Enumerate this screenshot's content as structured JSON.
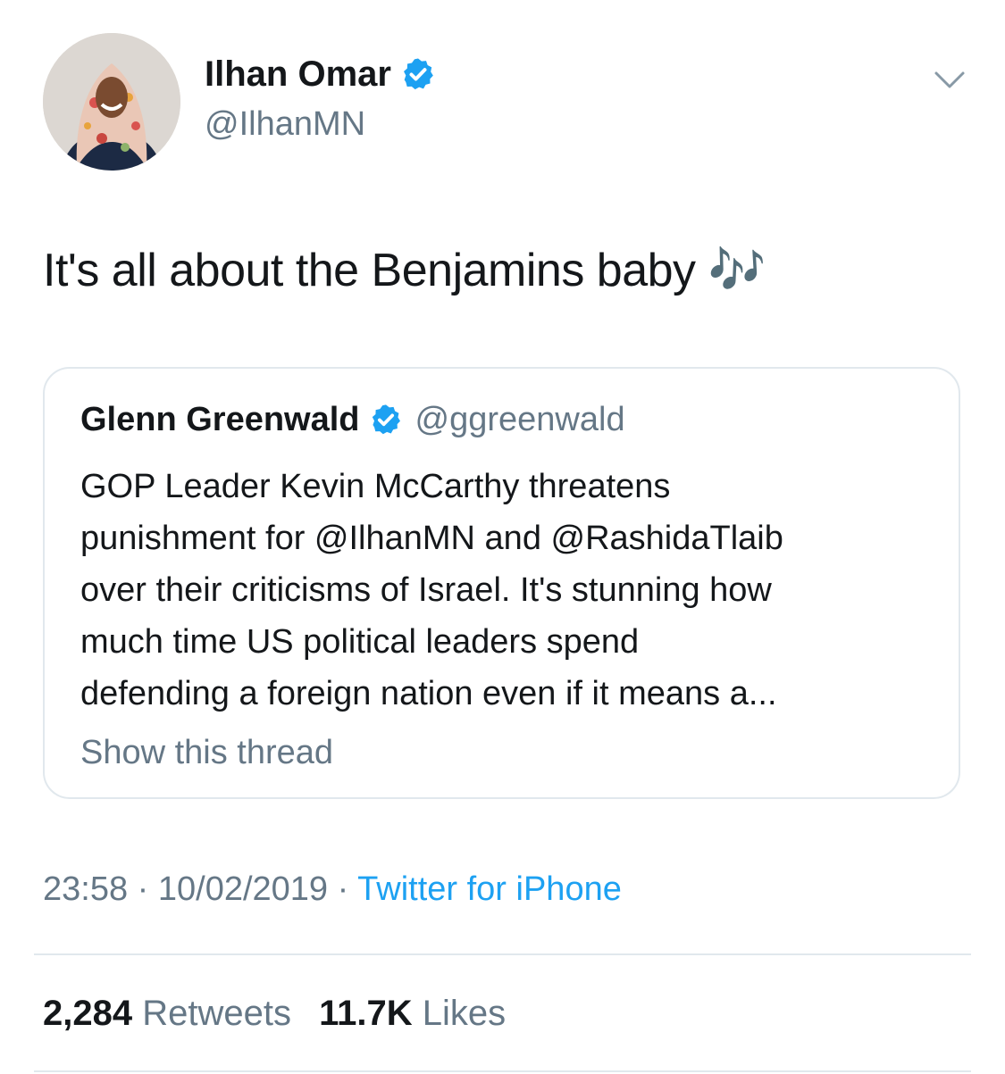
{
  "author": {
    "name": "Ilhan Omar",
    "handle": "@IlhanMN",
    "verified": true,
    "avatar_icon": "profile-photo"
  },
  "tweet": {
    "text": "It's all about the Benjamins baby 🎶",
    "timestamp": "23:58",
    "date": "10/02/2019",
    "separator": "·",
    "source": "Twitter for iPhone"
  },
  "quoted_tweet": {
    "name": "Glenn Greenwald",
    "handle": "@ggreenwald",
    "verified": true,
    "lines": [
      "GOP Leader Kevin McCarthy threatens",
      "punishment for @IlhanMN and @RashidaTlaib",
      "over their criticisms of Israel. It's stunning how",
      "much time US political leaders spend",
      "defending a foreign nation even if it means a..."
    ],
    "show_thread": "Show this thread"
  },
  "stats": {
    "retweets_count": "2,284",
    "retweets_label": "Retweets",
    "likes_count": "11.7K",
    "likes_label": "Likes"
  },
  "colors": {
    "text": "#14171a",
    "secondary": "#657786",
    "link": "#1da1f2",
    "verified": "#1da1f2",
    "border": "#e1e8ed"
  }
}
